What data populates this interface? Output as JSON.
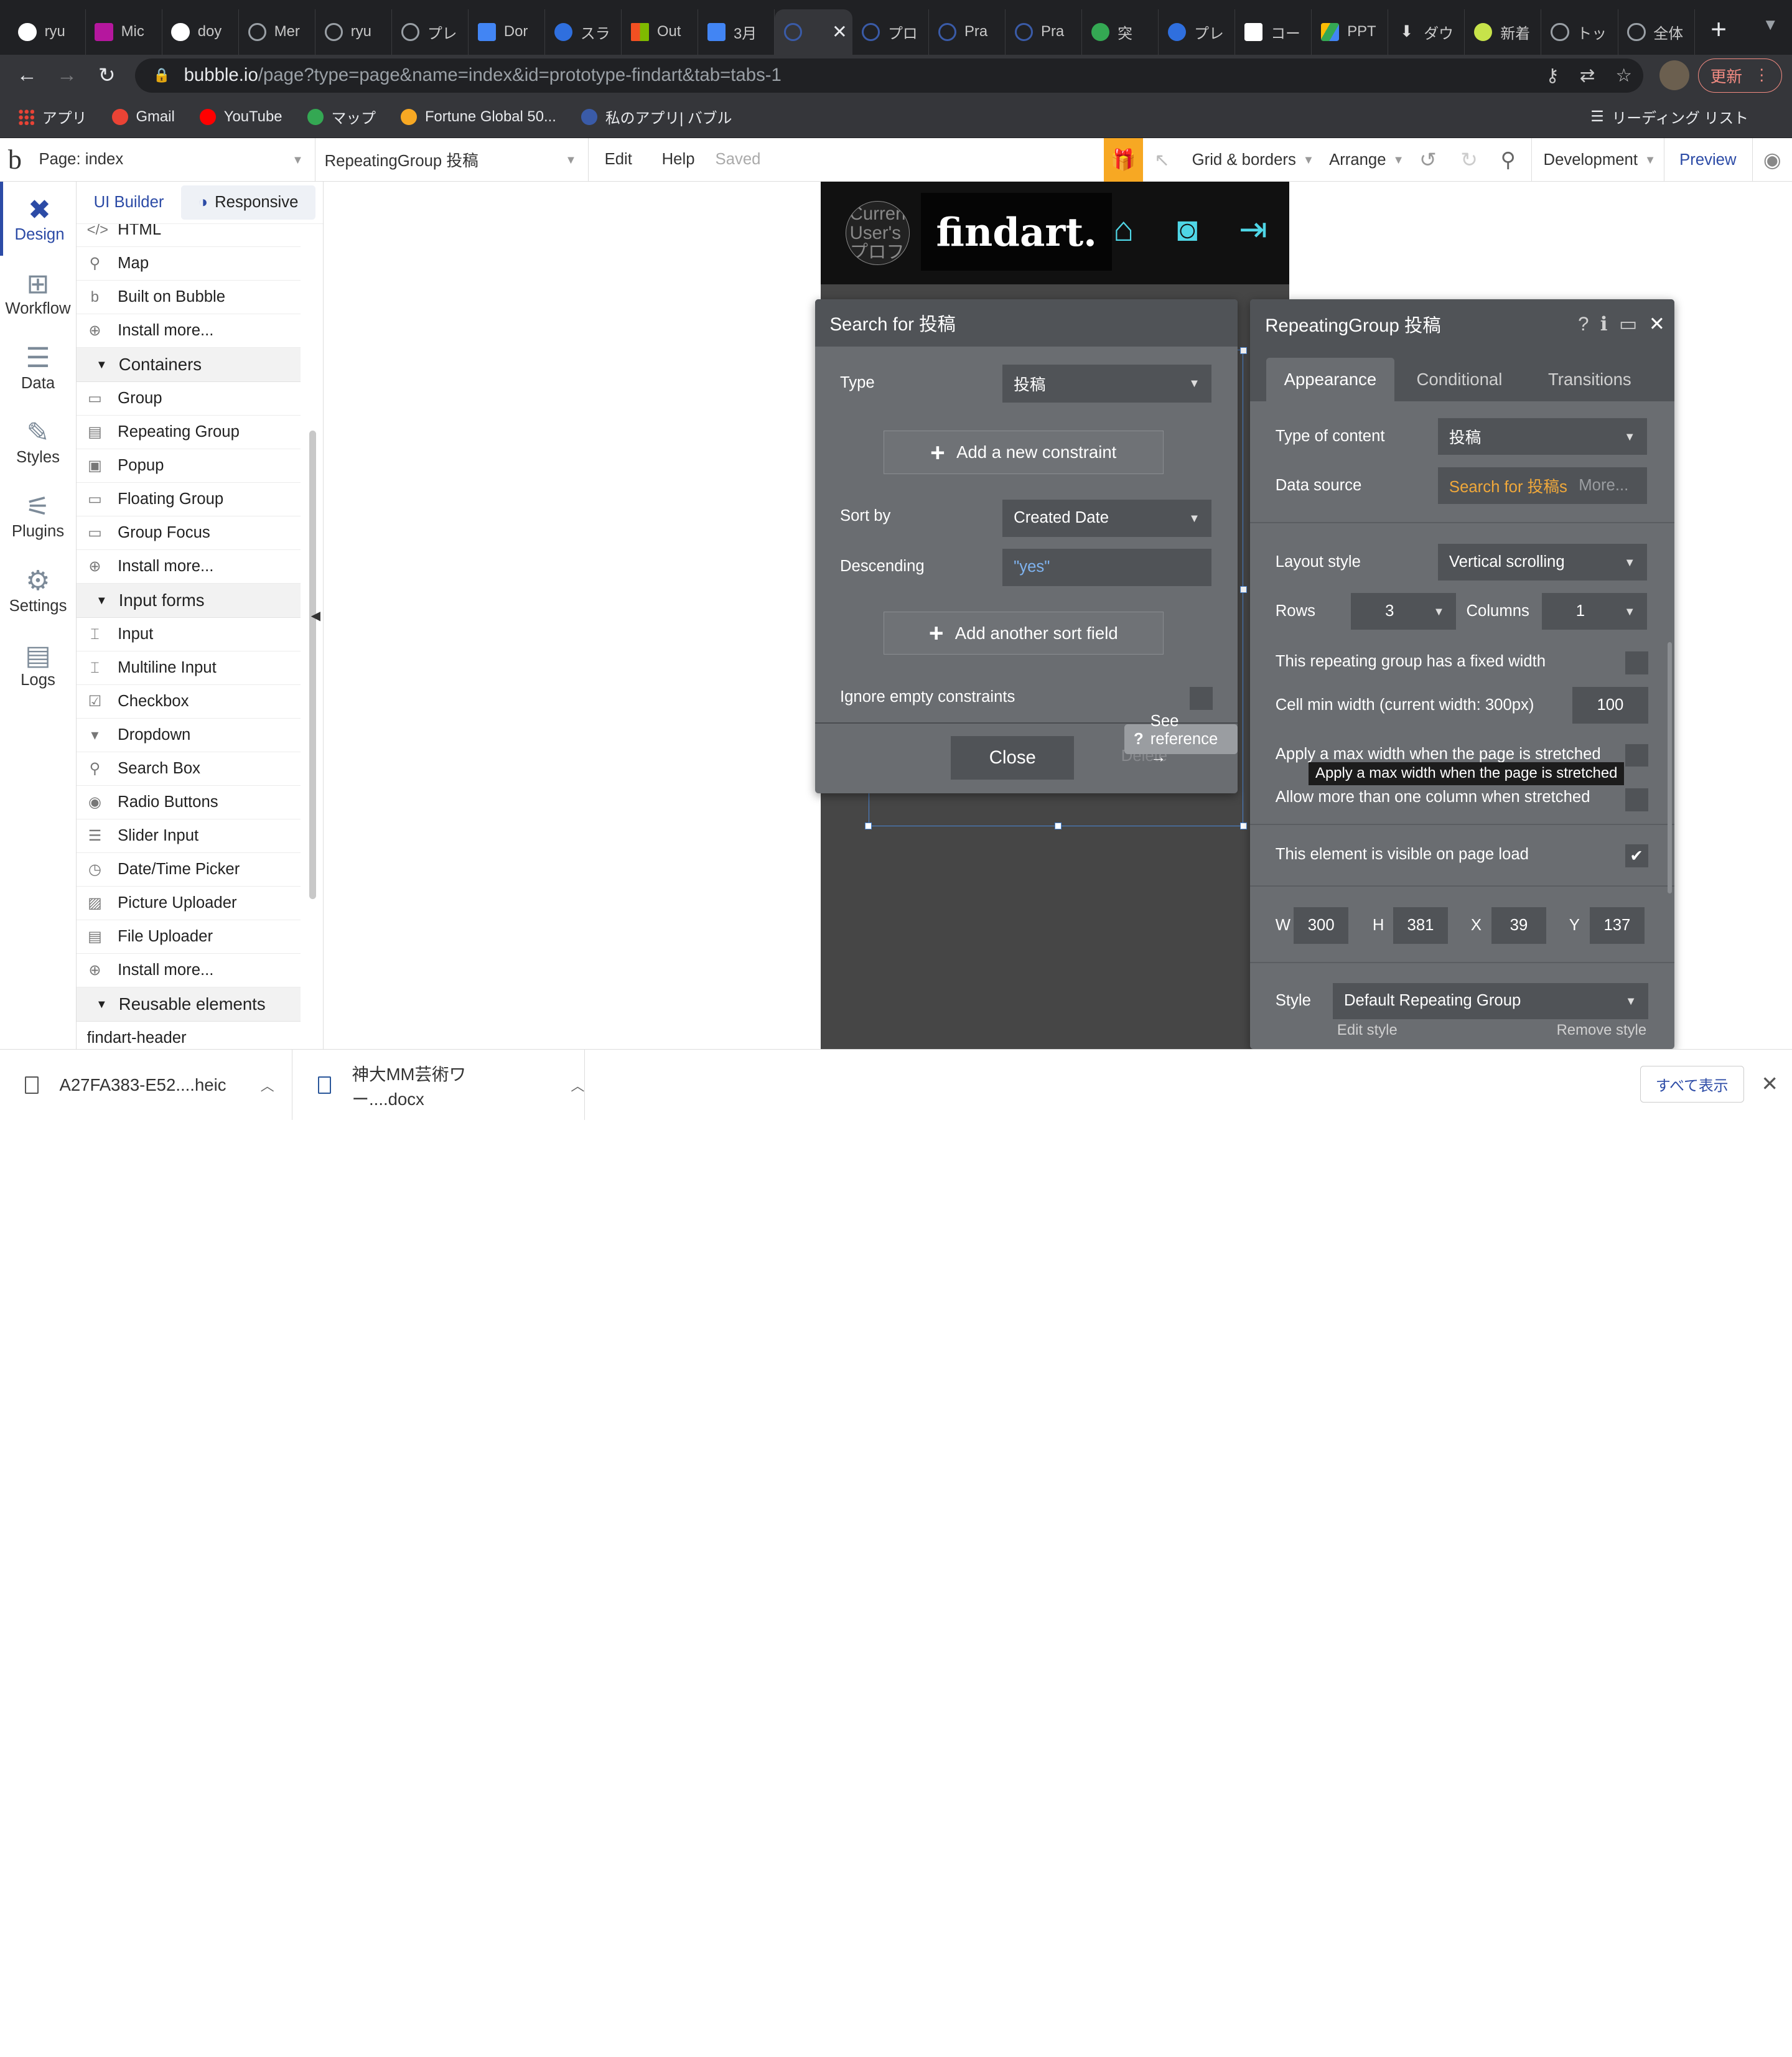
{
  "browser": {
    "tabs": [
      {
        "label": "ryu",
        "icon": "github-icon"
      },
      {
        "label": "Mic",
        "icon": "play-icon"
      },
      {
        "label": "doy",
        "icon": "circle-icon"
      },
      {
        "label": "Mer",
        "icon": "globe-icon"
      },
      {
        "label": "ryu",
        "icon": "globe-icon"
      },
      {
        "label": "プレ",
        "icon": "globe-icon"
      },
      {
        "label": "Dor",
        "icon": "doc-icon"
      },
      {
        "label": "スラ",
        "icon": "vscode-icon"
      },
      {
        "label": "Out",
        "icon": "microsoft-icon"
      },
      {
        "label": "3月",
        "icon": "docs-icon"
      },
      {
        "label": "",
        "icon": "bubble-icon",
        "active": true
      },
      {
        "label": "プロ",
        "icon": "bubble-icon"
      },
      {
        "label": "Pra",
        "icon": "bubble-icon"
      },
      {
        "label": "Pra",
        "icon": "bubble-icon"
      },
      {
        "label": "突​",
        "icon": "green-icon"
      },
      {
        "label": "プレ",
        "icon": "canva-icon"
      },
      {
        "label": "コー",
        "icon": "wiki-icon"
      },
      {
        "label": "PPT",
        "icon": "drive-icon"
      },
      {
        "label": "ダウ",
        "icon": "download-icon"
      },
      {
        "label": "新着",
        "icon": "leaf-icon"
      },
      {
        "label": "トッ",
        "icon": "globe-icon"
      },
      {
        "label": "全体",
        "icon": "globe-icon"
      }
    ],
    "url_host": "bubble.io",
    "url_path": "/page?type=page&name=index&id=prototype-findart&tab=tabs-1",
    "update_label": "更新",
    "bookmarks": [
      {
        "label": "アプリ",
        "icon": "apps-icon"
      },
      {
        "label": "Gmail",
        "icon": "google-icon"
      },
      {
        "label": "YouTube",
        "icon": "youtube-icon"
      },
      {
        "label": "マップ",
        "icon": "maps-icon"
      },
      {
        "label": "Fortune Global 50...",
        "icon": "fortune-icon"
      },
      {
        "label": "私のアプリ| バブル",
        "icon": "bubble-icon"
      }
    ],
    "reading_list": "リーディング リスト"
  },
  "bubble_toolbar": {
    "page_select": "Page: index",
    "element_select": "RepeatingGroup 投稿",
    "edit": "Edit",
    "help": "Help",
    "saved": "Saved",
    "grid": "Grid & borders",
    "arrange": "Arrange",
    "env": "Development",
    "preview": "Preview"
  },
  "rail": [
    {
      "label": "Design",
      "icon": "design-icon",
      "active": true
    },
    {
      "label": "Workflow",
      "icon": "workflow-icon"
    },
    {
      "label": "Data",
      "icon": "database-icon"
    },
    {
      "label": "Styles",
      "icon": "brush-icon"
    },
    {
      "label": "Plugins",
      "icon": "plug-icon"
    },
    {
      "label": "Settings",
      "icon": "gear-icon"
    },
    {
      "label": "Logs",
      "icon": "logs-icon"
    }
  ],
  "palette": {
    "tab_ui": "UI Builder",
    "tab_responsive": "Responsive",
    "rows": [
      {
        "type": "item",
        "label": "HTML",
        "icon": "</>"
      },
      {
        "type": "item",
        "label": "Map",
        "icon": "⚲"
      },
      {
        "type": "item",
        "label": "Built on Bubble",
        "icon": "b"
      },
      {
        "type": "item",
        "label": "Install more...",
        "icon": "⊕"
      },
      {
        "type": "section",
        "label": "Containers"
      },
      {
        "type": "item",
        "label": "Group",
        "icon": "▭"
      },
      {
        "type": "item",
        "label": "Repeating Group",
        "icon": "▤"
      },
      {
        "type": "item",
        "label": "Popup",
        "icon": "▣"
      },
      {
        "type": "item",
        "label": "Floating Group",
        "icon": "▭"
      },
      {
        "type": "item",
        "label": "Group Focus",
        "icon": "▭"
      },
      {
        "type": "item",
        "label": "Install more...",
        "icon": "⊕"
      },
      {
        "type": "section",
        "label": "Input forms"
      },
      {
        "type": "item",
        "label": "Input",
        "icon": "⌶"
      },
      {
        "type": "item",
        "label": "Multiline Input",
        "icon": "⌶"
      },
      {
        "type": "item",
        "label": "Checkbox",
        "icon": "☑"
      },
      {
        "type": "item",
        "label": "Dropdown",
        "icon": "▾"
      },
      {
        "type": "item",
        "label": "Search Box",
        "icon": "⚲"
      },
      {
        "type": "item",
        "label": "Radio Buttons",
        "icon": "◉"
      },
      {
        "type": "item",
        "label": "Slider Input",
        "icon": "☰"
      },
      {
        "type": "item",
        "label": "Date/Time Picker",
        "icon": "◷"
      },
      {
        "type": "item",
        "label": "Picture Uploader",
        "icon": "▨"
      },
      {
        "type": "item",
        "label": "File Uploader",
        "icon": "▤"
      },
      {
        "type": "item",
        "label": "Install more...",
        "icon": "⊕"
      },
      {
        "type": "section",
        "label": "Reusable elements"
      },
      {
        "type": "item",
        "label": "findart-header",
        "icon": ""
      }
    ]
  },
  "canvas": {
    "profile_text": "Current User's プロフィール画像",
    "logo_text": "findart.",
    "nav_icons": [
      "home-icon",
      "camera-icon",
      "sign-in-icon"
    ]
  },
  "search_dialog": {
    "title": "Search for 投稿",
    "type_label": "Type",
    "type_value": "投稿",
    "add_constraint": "Add a new constraint",
    "sort_label": "Sort by",
    "sort_value": "Created Date",
    "desc_label": "Descending",
    "desc_value": "\"yes\"",
    "add_sort": "Add another sort field",
    "ignore_label": "Ignore empty constraints",
    "close": "Close",
    "delete": "Delete",
    "see_ref": "See reference →"
  },
  "property_editor": {
    "title": "RepeatingGroup 投稿",
    "tabs": [
      "Appearance",
      "Conditional",
      "Transitions"
    ],
    "type_label": "Type of content",
    "type_value": "投稿",
    "source_label": "Data source",
    "source_value": "Search for 投稿s",
    "source_more": "More...",
    "layout_label": "Layout style",
    "layout_value": "Vertical scrolling",
    "rows_label": "Rows",
    "rows_value": "3",
    "cols_label": "Columns",
    "cols_value": "1",
    "fixed_width": "This repeating group has a fixed width",
    "min_width_label": "Cell min width (current width: 300px)",
    "min_width_value": "100",
    "max_width": "Apply a max width when the page is stretched",
    "multi_col": "Allow more than one column when stretched",
    "visible": "This element is visible on page load",
    "visible_checked": true,
    "w_label": "W",
    "w_value": "300",
    "h_label": "H",
    "h_value": "381",
    "x_label": "X",
    "x_value": "39",
    "y_label": "Y",
    "y_value": "137",
    "style_label": "Style",
    "style_value": "Default Repeating Group",
    "edit_style": "Edit style",
    "remove_style": "Remove style",
    "tooltip": "Apply a max width when the page is stretched"
  },
  "downloads": {
    "items": [
      "A27FA383-E52....heic",
      "神大MM芸術ワー....docx"
    ],
    "show_all": "すべて表示"
  },
  "colors": {
    "bubble_blue": "#2c4ba6",
    "panel": "#6a6d71",
    "panel_dark": "#505357",
    "accent_orange": "#f7a823",
    "link_orange": "#f0a83a",
    "icon_cyan": "#4fd6e6"
  }
}
